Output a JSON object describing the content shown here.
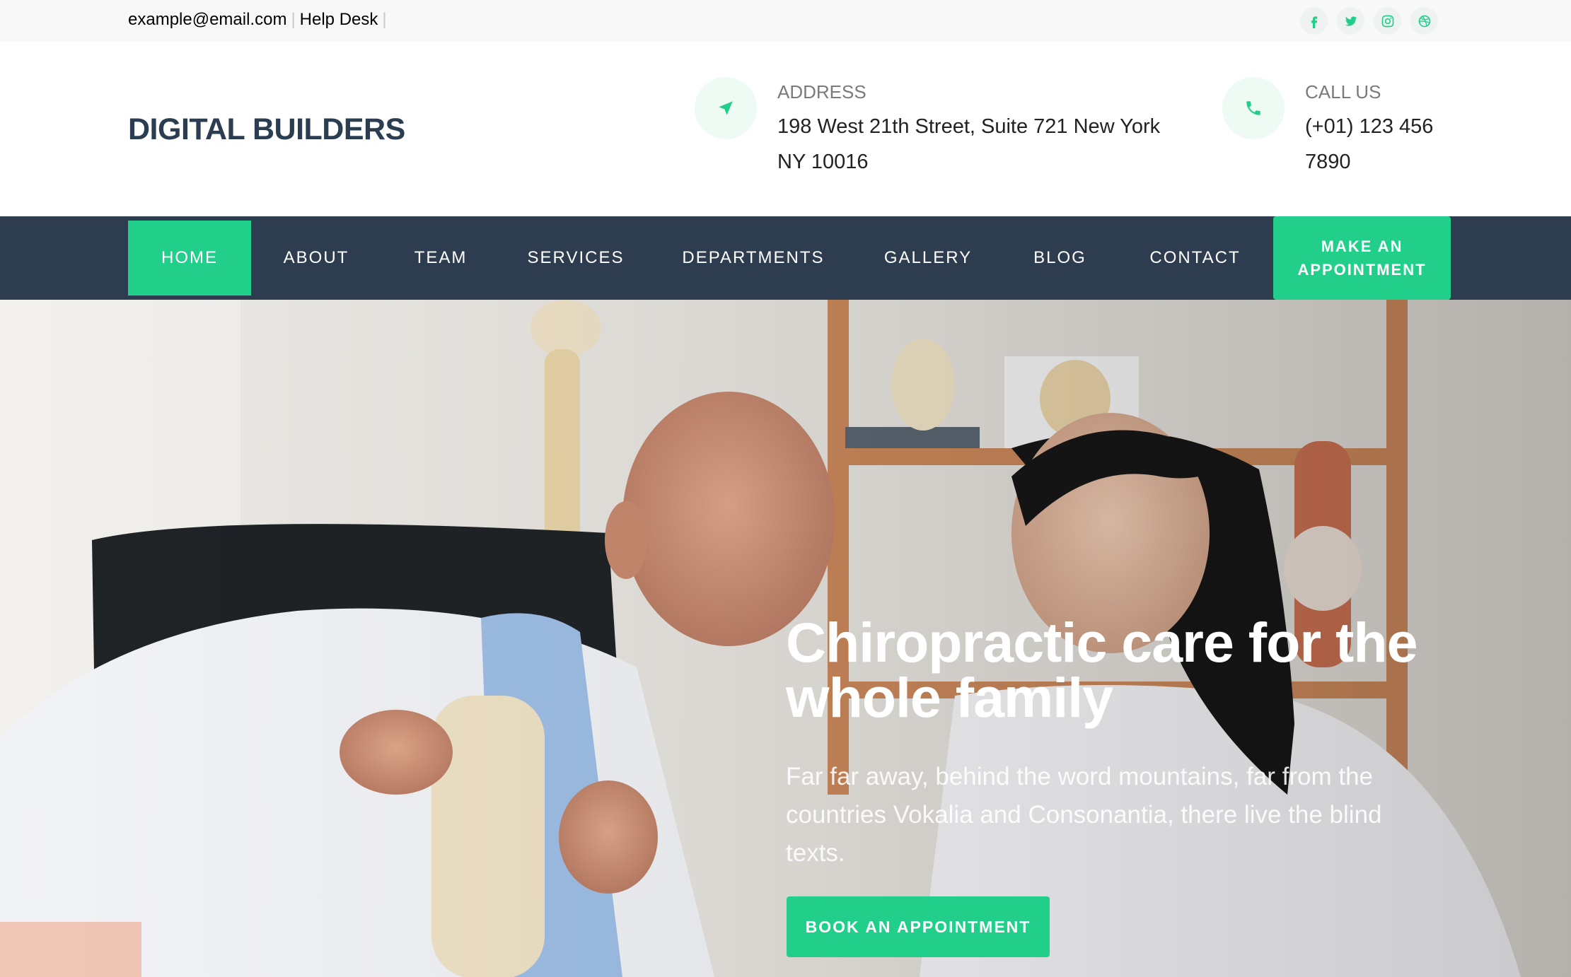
{
  "topbar": {
    "email": "example@email.com",
    "helpdesk": "Help Desk",
    "socials": [
      "facebook-icon",
      "twitter-icon",
      "instagram-icon",
      "dribbble-icon"
    ]
  },
  "header": {
    "logo": "DIGITAL BUILDERS",
    "address": {
      "label": "ADDRESS",
      "value": "198 West 21th Street, Suite 721 New York NY 10016",
      "icon": "navigation-arrow-icon"
    },
    "call": {
      "label": "CALL US",
      "value": "(+01) 123 456 7890",
      "icon": "phone-icon"
    }
  },
  "nav": {
    "items": [
      {
        "label": "HOME",
        "active": true
      },
      {
        "label": "ABOUT"
      },
      {
        "label": "TEAM"
      },
      {
        "label": "SERVICES"
      },
      {
        "label": "DEPARTMENTS"
      },
      {
        "label": "GALLERY"
      },
      {
        "label": "BLOG"
      },
      {
        "label": "CONTACT"
      }
    ],
    "cta": "MAKE AN APPOINTMENT"
  },
  "hero": {
    "title": "Chiropractic care for the whole family",
    "text": "Far far away, behind the word mountains, far from the countries Vokalia and Consonantia, there live the blind texts.",
    "button": "BOOK AN APPOINTMENT"
  },
  "colors": {
    "accent": "#22cf8a",
    "nav_bg": "#2d3d4f",
    "logo": "#2b3d51"
  }
}
